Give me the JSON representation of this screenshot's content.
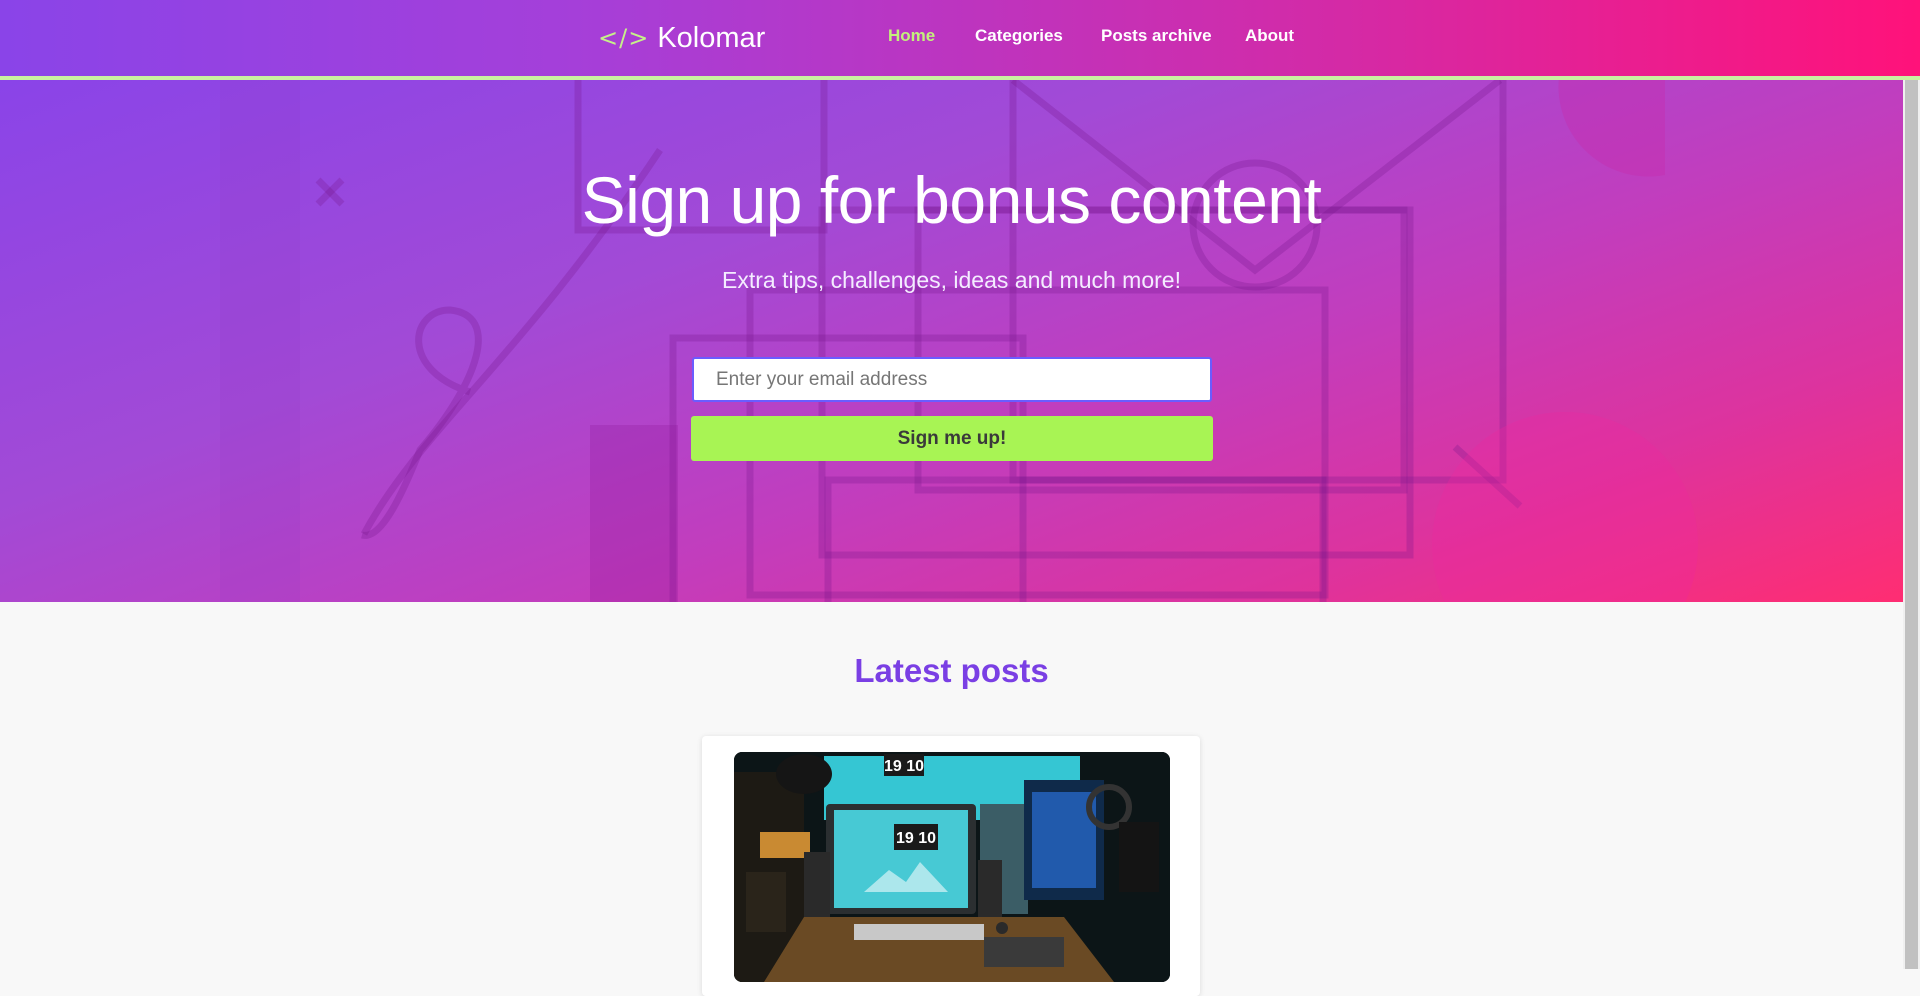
{
  "brand": {
    "code_glyph": "</>",
    "name": "Kolomar"
  },
  "nav": {
    "items": [
      {
        "label": "Home",
        "active": true
      },
      {
        "label": "Categories",
        "active": false
      },
      {
        "label": "Posts archive",
        "active": false
      },
      {
        "label": "About",
        "active": false
      }
    ]
  },
  "hero": {
    "title": "Sign up for bonus content",
    "subtitle": "Extra tips, challenges, ideas and much more!",
    "email_placeholder": "Enter your email address",
    "button_label": "Sign me up!"
  },
  "latest": {
    "title": "Latest posts",
    "clock_top": "19 10",
    "clock_screen": "19 10"
  },
  "colors": {
    "accent_green": "#a8f454",
    "nav_active": "#c3f07c",
    "title_purple": "#7a3fe4",
    "gradient_start": "#8a44e8",
    "gradient_end": "#ff127a"
  }
}
